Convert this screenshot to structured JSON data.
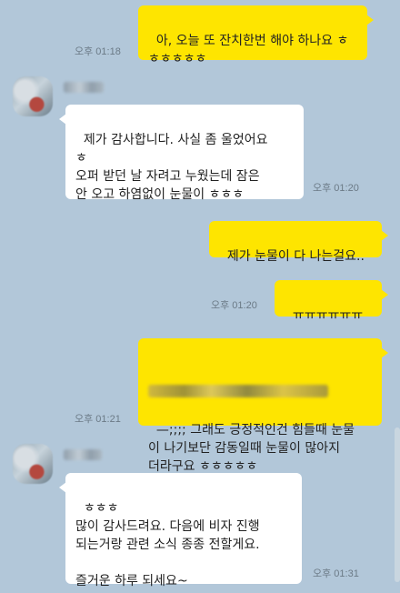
{
  "messages": [
    {
      "sender": "me",
      "text": "아, 오늘 또 잔치한번 해야 하나요 ㅎ\nㅎㅎㅎㅎㅎ",
      "time": "오후 01:18"
    },
    {
      "sender": "other",
      "text": "제가 감사합니다. 사실 좀 울었어요\nㅎ\n오퍼 받던 날 자려고 누웠는데 잠은\n안 오고 하염없이 눈물이 ㅎㅎㅎ",
      "time": "오후 01:20"
    },
    {
      "sender": "me",
      "text": "제가 눈물이 다 나는걸요..",
      "time": ""
    },
    {
      "sender": "me",
      "text": "ㅠㅠㅠㅠㅠㅠ",
      "time": "오후 01:20"
    },
    {
      "sender": "me",
      "text": "—;;;; 그래도 긍정적인건 힘들때 눈물\n이 나기보단 감동일때 눈물이 많아지\n더라구요 ㅎㅎㅎㅎㅎ",
      "time": "오후 01:21"
    },
    {
      "sender": "other",
      "text": "ㅎㅎㅎ\n많이 감사드려요. 다음에 비자 진행\n되는거랑 관련 소식 종종 전할게요.\n\n즐거운 하루 되세요~",
      "time": "오후 01:31"
    }
  ],
  "colors": {
    "background": "#b2c7d9",
    "my_bubble": "#fee500",
    "other_bubble": "#ffffff"
  }
}
